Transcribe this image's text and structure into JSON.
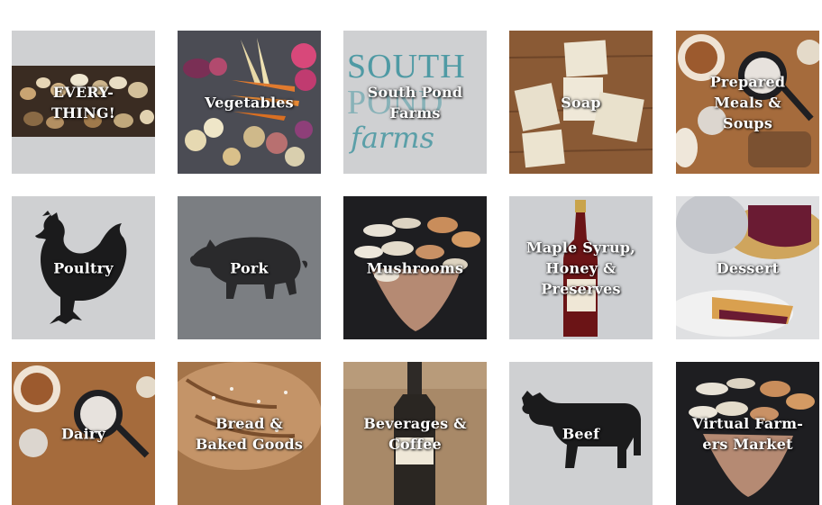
{
  "tiles": [
    {
      "label": "EVERY-\nTHING!",
      "icon": "produce-banner"
    },
    {
      "label": "Vegetables",
      "icon": "vegetables-photo"
    },
    {
      "label": "South Pond\nFarms",
      "icon": "south-pond-farms-logo",
      "logo_text": [
        "SOUTH",
        "POND",
        "farms"
      ]
    },
    {
      "label": "Soap",
      "icon": "soap-photo"
    },
    {
      "label": "Prepared\nMeals &\nSoups",
      "icon": "prepared-meals-photo"
    },
    {
      "label": "Poultry",
      "icon": "chicken-icon"
    },
    {
      "label": "Pork",
      "icon": "pig-icon"
    },
    {
      "label": "Mushrooms",
      "icon": "mushrooms-photo"
    },
    {
      "label": "Maple Syrup,\nHoney &\nPreserves",
      "icon": "syrup-bottle-photo"
    },
    {
      "label": "Dessert",
      "icon": "pie-photo"
    },
    {
      "label": "Dairy",
      "icon": "dairy-photo"
    },
    {
      "label": "Bread &\nBaked Goods",
      "icon": "bread-photo"
    },
    {
      "label": "Beverages &\nCoffee",
      "icon": "bottle-photo"
    },
    {
      "label": "Beef",
      "icon": "cow-icon"
    },
    {
      "label": "Virtual Farm-\ners Market",
      "icon": "market-photo"
    }
  ],
  "colors": {
    "tile_light": "#cfd0d2",
    "tile_mid": "#7b7e82",
    "logo_teal": "#4f9aa4",
    "label": "#ffffff"
  }
}
